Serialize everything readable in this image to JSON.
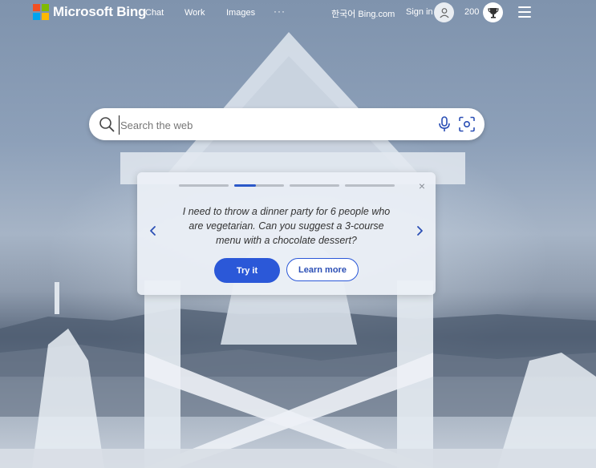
{
  "brand": {
    "name": "Microsoft Bing"
  },
  "nav": {
    "items": [
      {
        "label": "Chat"
      },
      {
        "label": "Work"
      },
      {
        "label": "Images"
      },
      {
        "label": "···"
      }
    ]
  },
  "header_right": {
    "region_link": "한국어 Bing.com",
    "sign_in": "Sign in",
    "rewards_points": "200"
  },
  "search": {
    "placeholder": "Search the web",
    "value": ""
  },
  "carousel": {
    "total_slides": 4,
    "active_slide": 2,
    "prompt": "I need to throw a dinner party for 6 people who are vegetarian. Can you suggest a 3-course menu with a chocolate dessert?",
    "try_label": "Try it",
    "learn_label": "Learn more",
    "close_glyph": "×"
  },
  "colors": {
    "accent": "#2b58d8",
    "ms_red": "#f25022",
    "ms_green": "#7fba00",
    "ms_blue": "#00a4ef",
    "ms_yellow": "#ffb900"
  },
  "icons": [
    "microsoft-logo-icon",
    "avatar-icon",
    "rewards-trophy-icon",
    "hamburger-menu-icon",
    "search-icon",
    "microphone-icon",
    "visual-search-icon",
    "close-icon",
    "chevron-left-icon",
    "chevron-right-icon"
  ]
}
